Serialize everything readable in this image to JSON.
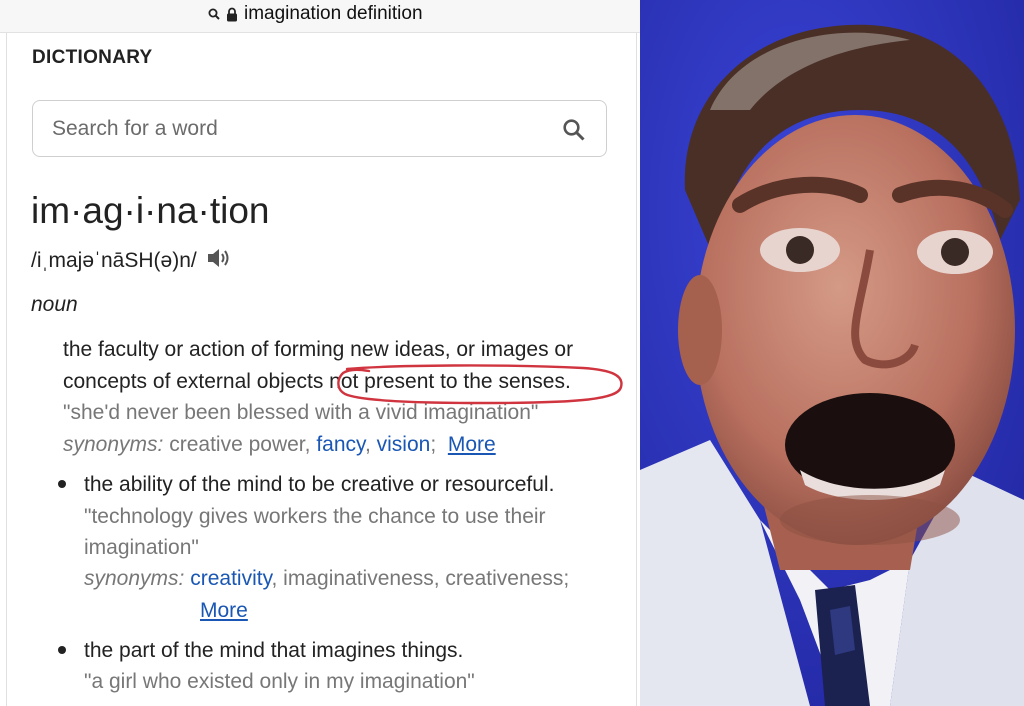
{
  "browser": {
    "url_text": "imagination definition"
  },
  "dictionary": {
    "label": "DICTIONARY",
    "search_placeholder": "Search for a word",
    "headword": "im·ag·i·na·tion",
    "phonetic": "/iˌmajəˈnāSH(ə)n/",
    "part_of_speech": "noun",
    "sense1": {
      "line1": "the faculty or action of forming new ideas, or images or",
      "line2_start": "concepts of external objects ",
      "line2_circled": "not present to the senses.",
      "example": "\"she'd never been blessed with a vivid imagination\"",
      "synonyms_label": "synonyms:",
      "syn_plain": "creative power,",
      "syn_link1": "fancy",
      "syn_link2": "vision",
      "more": "More"
    },
    "sense2": {
      "definition": "the ability of the mind to be creative or resourceful.",
      "example_line1": "\"technology gives workers the chance to use their",
      "example_line2": "imagination\"",
      "synonyms_label": "synonyms:",
      "syn_link": "creativity",
      "syn_rest": ", imaginativeness, creativeness;",
      "more": "More"
    },
    "sense3": {
      "definition": "the part of the mind that imagines things.",
      "example": "\"a girl who existed only in my imagination\""
    },
    "annotation_color": "#d0343f",
    "link_color": "#1a57b4"
  },
  "photo": {
    "background_color": "#2a2fb8"
  }
}
